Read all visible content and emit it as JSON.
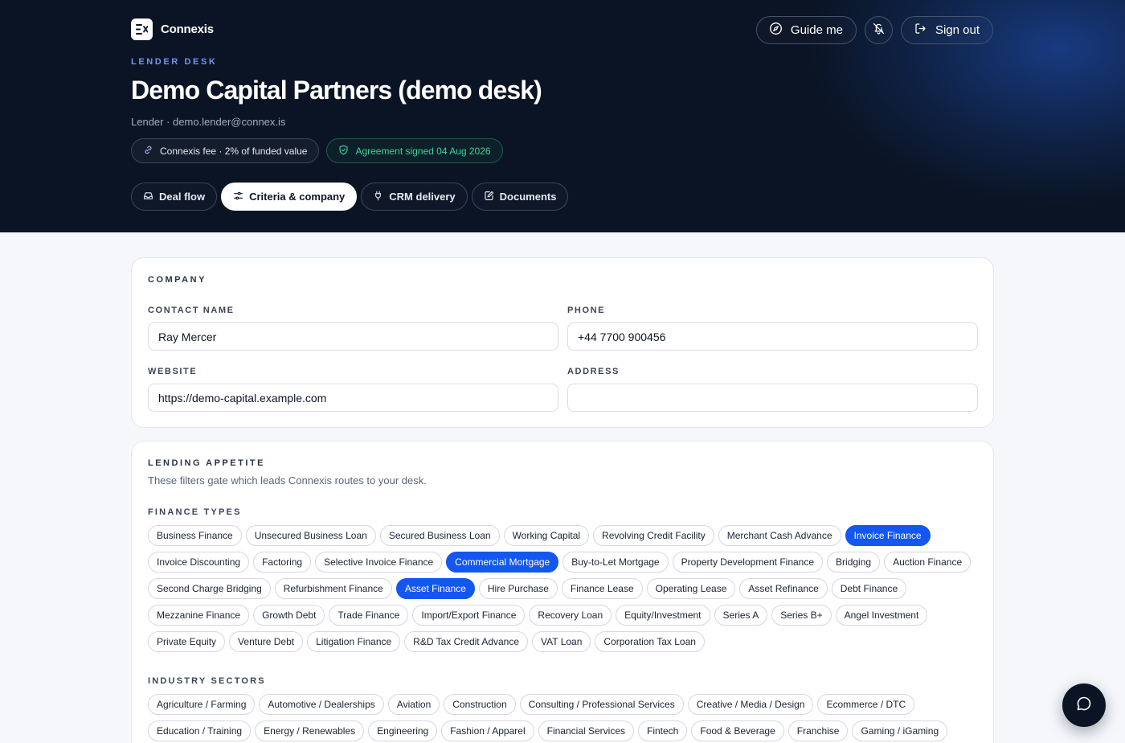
{
  "app": {
    "name": "Connexis",
    "logo_icon": "connexis-logo-icon"
  },
  "header_actions": {
    "guide_label": "Guide me",
    "sign_out_label": "Sign out",
    "icons": [
      "compass-icon",
      "bell-off-icon",
      "log-out-icon"
    ]
  },
  "hero": {
    "eyebrow": "LENDER DESK",
    "title": "Demo Capital Partners (demo desk)",
    "subtitle": "Lender · demo.lender@connex.is",
    "fee_pill": "Connexis fee · 2% of funded value",
    "agreement_pill": "Agreement signed 04 Aug 2026"
  },
  "tabs": [
    {
      "label": "Deal flow",
      "icon": "inbox-icon",
      "active": false
    },
    {
      "label": "Criteria & company",
      "icon": "sliders-icon",
      "active": true
    },
    {
      "label": "CRM delivery",
      "icon": "plug-icon",
      "active": false
    },
    {
      "label": "Documents",
      "icon": "edit-document-icon",
      "active": false
    }
  ],
  "company": {
    "section_label": "COMPANY",
    "contact_name_label": "CONTACT NAME",
    "contact_name_value": "Ray Mercer",
    "phone_label": "PHONE",
    "phone_value": "+44 7700 900456",
    "website_label": "WEBSITE",
    "website_value": "https://demo-capital.example.com",
    "address_label": "ADDRESS",
    "address_value": ""
  },
  "lending": {
    "section_label": "LENDING APPETITE",
    "helper": "These filters gate which leads Connexis routes to your desk.",
    "finance_types_label": "FINANCE TYPES",
    "finance_types": [
      {
        "label": "Business Finance",
        "selected": false
      },
      {
        "label": "Unsecured Business Loan",
        "selected": false
      },
      {
        "label": "Secured Business Loan",
        "selected": false
      },
      {
        "label": "Working Capital",
        "selected": false
      },
      {
        "label": "Revolving Credit Facility",
        "selected": false
      },
      {
        "label": "Merchant Cash Advance",
        "selected": false
      },
      {
        "label": "Invoice Finance",
        "selected": true
      },
      {
        "label": "Invoice Discounting",
        "selected": false
      },
      {
        "label": "Factoring",
        "selected": false
      },
      {
        "label": "Selective Invoice Finance",
        "selected": false
      },
      {
        "label": "Commercial Mortgage",
        "selected": true
      },
      {
        "label": "Buy-to-Let Mortgage",
        "selected": false
      },
      {
        "label": "Property Development Finance",
        "selected": false
      },
      {
        "label": "Bridging",
        "selected": false
      },
      {
        "label": "Auction Finance",
        "selected": false
      },
      {
        "label": "Second Charge Bridging",
        "selected": false
      },
      {
        "label": "Refurbishment Finance",
        "selected": false
      },
      {
        "label": "Asset Finance",
        "selected": true
      },
      {
        "label": "Hire Purchase",
        "selected": false
      },
      {
        "label": "Finance Lease",
        "selected": false
      },
      {
        "label": "Operating Lease",
        "selected": false
      },
      {
        "label": "Asset Refinance",
        "selected": false
      },
      {
        "label": "Debt Finance",
        "selected": false
      },
      {
        "label": "Mezzanine Finance",
        "selected": false
      },
      {
        "label": "Growth Debt",
        "selected": false
      },
      {
        "label": "Trade Finance",
        "selected": false
      },
      {
        "label": "Import/Export Finance",
        "selected": false
      },
      {
        "label": "Recovery Loan",
        "selected": false
      },
      {
        "label": "Equity/Investment",
        "selected": false
      },
      {
        "label": "Series A",
        "selected": false
      },
      {
        "label": "Series B+",
        "selected": false
      },
      {
        "label": "Angel Investment",
        "selected": false
      },
      {
        "label": "Private Equity",
        "selected": false
      },
      {
        "label": "Venture Debt",
        "selected": false
      },
      {
        "label": "Litigation Finance",
        "selected": false
      },
      {
        "label": "R&D Tax Credit Advance",
        "selected": false
      },
      {
        "label": "VAT Loan",
        "selected": false
      },
      {
        "label": "Corporation Tax Loan",
        "selected": false
      }
    ],
    "industry_sectors_label": "INDUSTRY SECTORS",
    "industry_sectors": [
      {
        "label": "Agriculture / Farming",
        "selected": false
      },
      {
        "label": "Automotive / Dealerships",
        "selected": false
      },
      {
        "label": "Aviation",
        "selected": false
      },
      {
        "label": "Construction",
        "selected": false
      },
      {
        "label": "Consulting / Professional Services",
        "selected": false
      },
      {
        "label": "Creative / Media / Design",
        "selected": false
      },
      {
        "label": "Ecommerce / DTC",
        "selected": false
      },
      {
        "label": "Education / Training",
        "selected": false
      },
      {
        "label": "Energy / Renewables",
        "selected": false
      },
      {
        "label": "Engineering",
        "selected": false
      },
      {
        "label": "Fashion / Apparel",
        "selected": false
      },
      {
        "label": "Financial Services",
        "selected": false
      },
      {
        "label": "Fintech",
        "selected": false
      },
      {
        "label": "Food & Beverage",
        "selected": false
      },
      {
        "label": "Franchise",
        "selected": false
      },
      {
        "label": "Gaming / iGaming",
        "selected": false
      }
    ]
  },
  "chat": {
    "icon": "chat-bubble-icon"
  },
  "colors": {
    "hero_bg": "#0a1424",
    "accent": "#1456f0",
    "eyebrow": "#6a97f5",
    "agreement_green": "#3fd29a"
  }
}
